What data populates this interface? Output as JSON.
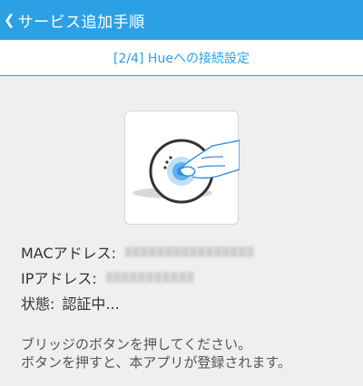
{
  "appbar": {
    "title": "サービス追加手順",
    "back_icon": "chevron-left-icon",
    "color": "#2ba0e4"
  },
  "subheader": {
    "title": "[2/4] Hueへの接続設定"
  },
  "illustration": {
    "icon": "hue-bridge-press-button-icon"
  },
  "info": {
    "mac_label": "MACアドレス:",
    "ip_label": "IPアドレス:",
    "status_label": "状態:",
    "status_value": "認証中..."
  },
  "instruction": {
    "line1": "ブリッジのボタンを押してください。",
    "line2": "ボタンを押すと、本アプリが登録されます。"
  }
}
